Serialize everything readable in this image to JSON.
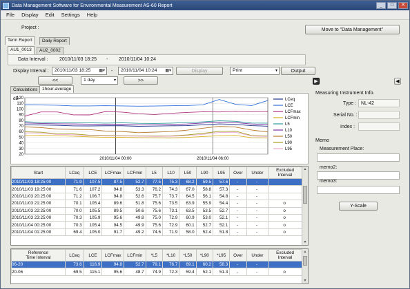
{
  "window": {
    "title": "Data Management Software for Environmental Measurement AS-60 Report"
  },
  "menu": [
    "File",
    "Display",
    "Edit",
    "Settings",
    "Help"
  ],
  "project": {
    "label": "Project :",
    "value": ""
  },
  "move_button": "Move to \"Data Management\"",
  "report_tabs": [
    "Term Report",
    "Daily Report"
  ],
  "file_tabs": [
    "AU1_0013",
    "AU2_0002"
  ],
  "data_interval": {
    "label": "Data Interval :",
    "start": "2010/11/03 18:25",
    "sep": "-",
    "end": "2010/11/04 10:24"
  },
  "display_interval": {
    "label": "Display Interval :",
    "start": "2010/11/03 18:25",
    "sep": "-",
    "end": "2010/11/04 10:24"
  },
  "display_button": "Display",
  "print_combo": "Print",
  "output_button": "Output",
  "nav": {
    "prev": "<<",
    "span": "1 day",
    "next": ">>"
  },
  "sub_tabs": [
    "Calculations",
    "1hour-average"
  ],
  "chart_data": {
    "type": "line",
    "ylabel": "dB",
    "ylim": [
      20,
      120
    ],
    "yticks": [
      120,
      110,
      100,
      90,
      80,
      70,
      60,
      50,
      40,
      30,
      20
    ],
    "x_labels": [
      "2010/11/04 00:00",
      "2010/11/04 06:00"
    ],
    "x": [
      "18:25",
      "19:25",
      "20:25",
      "21:25",
      "22:25",
      "23:25",
      "00:25",
      "01:25",
      "02:25",
      "03:25",
      "04:25",
      "05:25",
      "06:20",
      "07:20",
      "08:20",
      "09:20"
    ],
    "series": [
      {
        "name": "LCeq",
        "color": "#1c2f8c",
        "values": [
          71.9,
          71.6,
          71.2,
          70.1,
          70.0,
          70.3,
          70.3,
          69.4,
          69.8,
          70.2,
          70.5,
          72.0,
          73.6,
          72.8,
          70.5,
          69.5
        ]
      },
      {
        "name": "LCE",
        "color": "#2f6fd8",
        "values": [
          107.5,
          107.2,
          106.7,
          105.4,
          105.5,
          105.9,
          105.4,
          105.0,
          105.3,
          105.8,
          106.0,
          107.4,
          116.9,
          108.3,
          106.1,
          115.1
        ]
      },
      {
        "name": "LCFmax",
        "color": "#b03080",
        "values": [
          87.5,
          94.8,
          94.8,
          89.6,
          89.5,
          95.6,
          94.5,
          91.7,
          90.2,
          92.3,
          93.8,
          95.1,
          94.8,
          96.0,
          95.2,
          95.6
        ]
      },
      {
        "name": "LCFmin",
        "color": "#d9b020",
        "values": [
          52.7,
          53.3,
          52.6,
          51.8,
          50.6,
          49.8,
          49.9,
          49.2,
          48.9,
          48.5,
          49.6,
          51.2,
          52.7,
          53.2,
          49.0,
          48.7
        ]
      },
      {
        "name": "L5",
        "color": "#2a9a9a",
        "values": [
          77.5,
          76.2,
          75.7,
          75.6,
          75.6,
          75.0,
          75.6,
          74.6,
          74.4,
          75.0,
          75.9,
          77.3,
          79.1,
          78.2,
          75.1,
          74.9
        ]
      },
      {
        "name": "L10",
        "color": "#7a2fa0",
        "values": [
          75.3,
          74.3,
          73.7,
          73.5,
          73.1,
          72.9,
          72.9,
          71.9,
          72.0,
          72.6,
          73.4,
          75.1,
          76.7,
          75.9,
          73.4,
          72.3
        ]
      },
      {
        "name": "L50",
        "color": "#b87a2a",
        "values": [
          68.2,
          67.0,
          64.5,
          63.9,
          63.5,
          60.9,
          60.1,
          58.0,
          58.9,
          60.0,
          62.4,
          66.0,
          69.1,
          68.0,
          62.7,
          59.4
        ]
      },
      {
        "name": "L90",
        "color": "#a8a020",
        "values": [
          59.5,
          58.8,
          56.1,
          55.9,
          53.5,
          53.0,
          52.7,
          52.4,
          52.0,
          52.4,
          54.0,
          56.9,
          60.2,
          60.7,
          53.0,
          52.1
        ]
      },
      {
        "name": "L95",
        "color": "#e8a8d0",
        "values": [
          57.6,
          57.3,
          54.8,
          54.4,
          52.7,
          52.1,
          52.1,
          51.8,
          51.3,
          51.7,
          52.6,
          55.2,
          58.3,
          58.8,
          52.1,
          51.3
        ]
      }
    ]
  },
  "grid1": {
    "headers": [
      "Start",
      "LCeq",
      "LCE",
      "LCFmax",
      "LCFmin",
      "L5",
      "L10",
      "L50",
      "L90",
      "L95",
      "Over",
      "Under",
      "Excluded\nInterval"
    ],
    "rows": [
      [
        "2010/11/03 18:25:00",
        "71.9",
        "107.5",
        "87.5",
        "52.7",
        "77.5",
        "75.3",
        "68.2",
        "59.5",
        "57.6",
        "-",
        "-",
        ""
      ],
      [
        "2010/11/03 19:25:00",
        "71.6",
        "107.2",
        "94.8",
        "53.3",
        "76.2",
        "74.3",
        "67.0",
        "58.8",
        "57.3",
        "-",
        "-",
        ""
      ],
      [
        "2010/11/03 20:25:00",
        "71.2",
        "106.7",
        "94.8",
        "52.6",
        "75.7",
        "73.7",
        "64.5",
        "56.1",
        "54.8",
        "-",
        "-",
        ""
      ],
      [
        "2010/11/03 21:25:00",
        "70.1",
        "105.4",
        "89.6",
        "51.8",
        "75.6",
        "73.5",
        "63.9",
        "55.9",
        "54.4",
        "-",
        "-",
        "o"
      ],
      [
        "2010/11/03 22:25:00",
        "70.0",
        "105.5",
        "89.5",
        "50.6",
        "75.6",
        "73.1",
        "63.5",
        "53.5",
        "52.7",
        "-",
        "-",
        "o"
      ],
      [
        "2010/11/03 23:25:00",
        "70.3",
        "105.9",
        "95.6",
        "49.8",
        "75.0",
        "72.9",
        "60.9",
        "53.0",
        "52.1",
        "-",
        "-",
        "o"
      ],
      [
        "2010/11/04 00:25:00",
        "70.3",
        "105.4",
        "94.5",
        "49.9",
        "75.6",
        "72.9",
        "60.1",
        "52.7",
        "52.1",
        "-",
        "-",
        "o"
      ],
      [
        "2010/11/04 01:25:00",
        "69.4",
        "105.0",
        "91.7",
        "49.2",
        "74.6",
        "71.9",
        "58.0",
        "52.4",
        "51.8",
        "-",
        "-",
        "o"
      ]
    ]
  },
  "grid2": {
    "headers": [
      "Reference\nTime Interval",
      "LCeq",
      "LCE",
      "LCFmax",
      "LCFmin",
      "*L5",
      "*L10",
      "*L50",
      "*L90",
      "*L95",
      "Over",
      "Under",
      "Excluded\nInterval"
    ],
    "rows": [
      [
        "06-20",
        "73.6",
        "116.9",
        "94.8",
        "52.7",
        "79.1",
        "76.7",
        "69.1",
        "60.2",
        "58.3",
        "-",
        "-",
        ""
      ],
      [
        "20-06",
        "69.5",
        "115.1",
        "95.6",
        "48.7",
        "74.9",
        "72.3",
        "59.4",
        "52.1",
        "51.3",
        "-",
        "-",
        "o"
      ]
    ]
  },
  "instrument": {
    "heading": "Measuring Instrument Info.",
    "type_label": "Type :",
    "type_value": "NL-42",
    "serial_label": "Serial No. :",
    "serial_value": "",
    "index_label": "Index :",
    "index_value": ""
  },
  "memo": {
    "heading": "Memo",
    "place_label": "Measurement Place:",
    "memo2_label": "memo2:",
    "memo3_label": "memo3:"
  },
  "yscale_button": "Y-Scale"
}
